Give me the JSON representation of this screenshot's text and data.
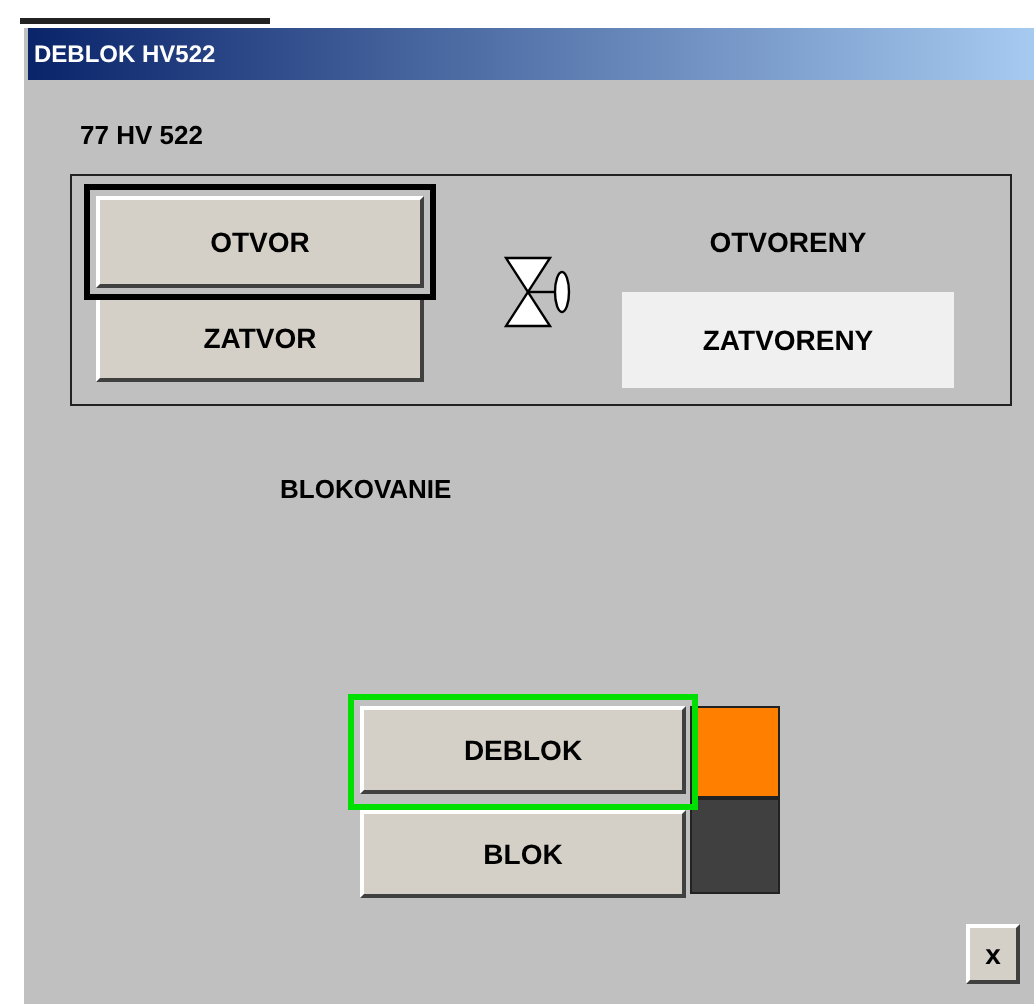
{
  "window": {
    "title": "DEBLOK HV522"
  },
  "tag": "77 HV 522",
  "valve_buttons": [
    {
      "label": "OTVOR",
      "focused": true
    },
    {
      "label": "ZATVOR",
      "focused": false
    }
  ],
  "valve_states": [
    {
      "label": "OTVORENY",
      "selected": false
    },
    {
      "label": "ZATVORENY",
      "selected": true
    }
  ],
  "block_section": {
    "title": "BLOKOVANIE"
  },
  "block_buttons": [
    {
      "label": "DEBLOK",
      "focused": true,
      "color": "#ff8000"
    },
    {
      "label": "BLOK",
      "focused": false,
      "color": "#404040"
    }
  ],
  "close_button": {
    "label": "x"
  }
}
